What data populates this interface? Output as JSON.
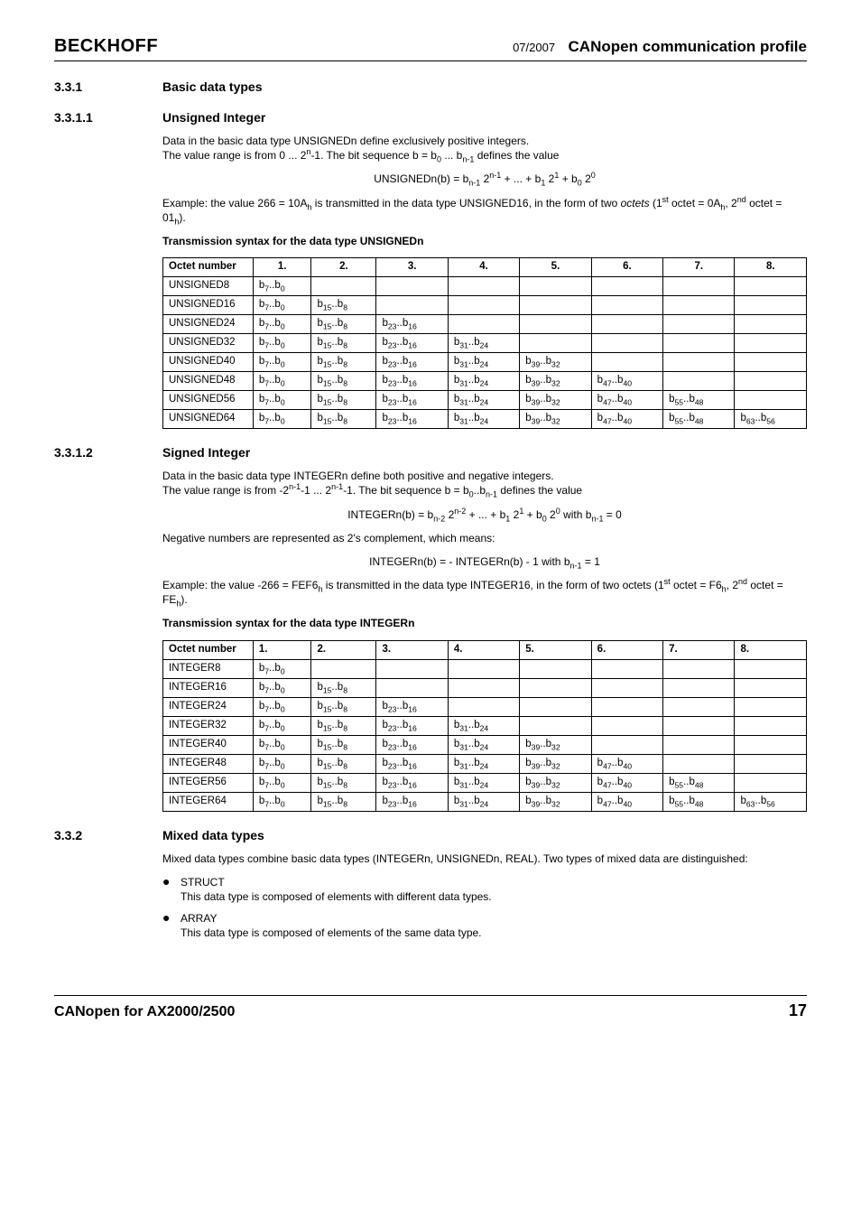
{
  "header": {
    "brand": "BECKHOFF",
    "date": "07/2007",
    "profile": "CANopen communication profile"
  },
  "s331": {
    "num": "3.3.1",
    "title": "Basic data types"
  },
  "s3311": {
    "num": "3.3.1.1",
    "title": "Unsigned Integer",
    "p1a": "Data in the basic data type UNSIGNEDn define exclusively positive integers.",
    "p1b_pre": "The value range is from 0 ... 2",
    "p1b_sup": "n",
    "p1b_post": "-1. The bit sequence b = b",
    "p1b_s1": "0",
    "p1b_mid": " ... b",
    "p1b_s2": "n-1",
    "p1b_end": " defines the value",
    "formula_lhs": "UNSIGNEDn(b) = b",
    "p2a": "Example: the value 266 = 10A",
    "p2b": " is transmitted in the data type UNSIGNED16, in the form of two ",
    "p2c": "octets",
    "p2d": " (1",
    "p2e": " octet = 0A",
    "p2f": ", 2",
    "p2g": " octet = 01",
    "p2h": ").",
    "table_caption": "Transmission syntax for the data type UNSIGNEDn"
  },
  "tableA": {
    "head": [
      "Octet number",
      "1.",
      "2.",
      "3.",
      "4.",
      "5.",
      "6.",
      "7.",
      "8."
    ],
    "rows": [
      {
        "n": "UNSIGNED8",
        "c": [
          1
        ]
      },
      {
        "n": "UNSIGNED16",
        "c": [
          1,
          2
        ]
      },
      {
        "n": "UNSIGNED24",
        "c": [
          1,
          2,
          3
        ]
      },
      {
        "n": "UNSIGNED32",
        "c": [
          1,
          2,
          3,
          4
        ]
      },
      {
        "n": "UNSIGNED40",
        "c": [
          1,
          2,
          3,
          4,
          5
        ]
      },
      {
        "n": "UNSIGNED48",
        "c": [
          1,
          2,
          3,
          4,
          5,
          6
        ]
      },
      {
        "n": "UNSIGNED56",
        "c": [
          1,
          2,
          3,
          4,
          5,
          6,
          7
        ]
      },
      {
        "n": "UNSIGNED64",
        "c": [
          1,
          2,
          3,
          4,
          5,
          6,
          7,
          8
        ]
      }
    ]
  },
  "bitCells": [
    {
      "hi": "7",
      "lo": "0"
    },
    {
      "hi": "15",
      "lo": "8"
    },
    {
      "hi": "23",
      "lo": "16"
    },
    {
      "hi": "31",
      "lo": "24"
    },
    {
      "hi": "39",
      "lo": "32"
    },
    {
      "hi": "47",
      "lo": "40"
    },
    {
      "hi": "55",
      "lo": "48"
    },
    {
      "hi": "63",
      "lo": "56"
    }
  ],
  "s3312": {
    "num": "3.3.1.2",
    "title": "Signed Integer",
    "p1a": "Data in the basic data type INTEGERn define both positive and negative integers.",
    "p1b": "The value range is from  -2",
    "p1b2": "-1 ... 2",
    "p1b3": "-1. The bit sequence b = b",
    "p1b4": "..b",
    "p1b5": " defines the value",
    "formula1": "INTEGERn(b) = b",
    "neg1": "Negative numbers are represented as 2's complement, which means:",
    "neg2a": "INTEGERn(b) = - INTEGERn(b) - 1 with b",
    "neg2b": " = 1",
    "ex1": "Example: the value -266 = FEF6",
    "ex2": " is transmitted in the data type INTEGER16, in the form of two octets (1",
    "ex3": " octet = F6",
    "ex4": ", 2",
    "ex5": " octet = FE",
    "ex6": ").",
    "table_caption": "Transmission syntax for the data type INTEGERn"
  },
  "tableB": {
    "head": [
      "Octet number",
      "1.",
      "2.",
      "3.",
      "4.",
      "5.",
      "6.",
      "7.",
      "8."
    ],
    "rows": [
      {
        "n": "INTEGER8",
        "c": [
          1
        ]
      },
      {
        "n": "INTEGER16",
        "c": [
          1,
          2
        ]
      },
      {
        "n": "INTEGER24",
        "c": [
          1,
          2,
          3
        ]
      },
      {
        "n": "INTEGER32",
        "c": [
          1,
          2,
          3,
          4
        ]
      },
      {
        "n": "INTEGER40",
        "c": [
          1,
          2,
          3,
          4,
          5
        ]
      },
      {
        "n": "INTEGER48",
        "c": [
          1,
          2,
          3,
          4,
          5,
          6
        ]
      },
      {
        "n": "INTEGER56",
        "c": [
          1,
          2,
          3,
          4,
          5,
          6,
          7
        ]
      },
      {
        "n": "INTEGER64",
        "c": [
          1,
          2,
          3,
          4,
          5,
          6,
          7,
          8
        ]
      }
    ]
  },
  "s332": {
    "num": "3.3.2",
    "title": "Mixed data types",
    "intro": "Mixed data types combine basic data types (INTEGERn, UNSIGNEDn, REAL). Two types of mixed data are distinguished:",
    "b1t": "STRUCT",
    "b1d": "This data type is composed of elements with different data types.",
    "b2t": "ARRAY",
    "b2d": "This data type is composed of elements of the same data type."
  },
  "footer": {
    "left": "CANopen for AX2000/2500",
    "right": "17"
  }
}
